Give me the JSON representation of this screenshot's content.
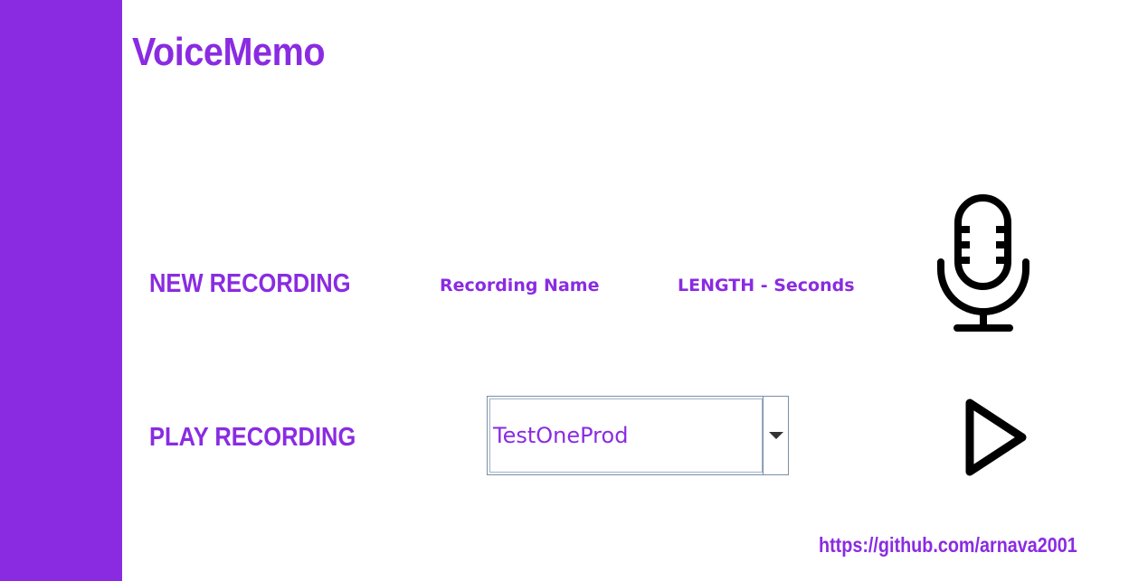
{
  "app": {
    "title": "VoiceMemo"
  },
  "new_recording": {
    "label": "NEW RECORDING",
    "name_label": "Recording Name",
    "length_label": "LENGTH - Seconds",
    "record_icon": "microphone-icon"
  },
  "play_recording": {
    "label": "PLAY RECORDING",
    "selected_recording": "TestOneProd",
    "dropdown_icon": "chevron-down-icon",
    "play_icon": "play-icon"
  },
  "footer": {
    "link_text": "https://github.com/arnava2001"
  },
  "colors": {
    "accent": "#8a2be2",
    "background": "#ffffff",
    "icon": "#000000"
  }
}
